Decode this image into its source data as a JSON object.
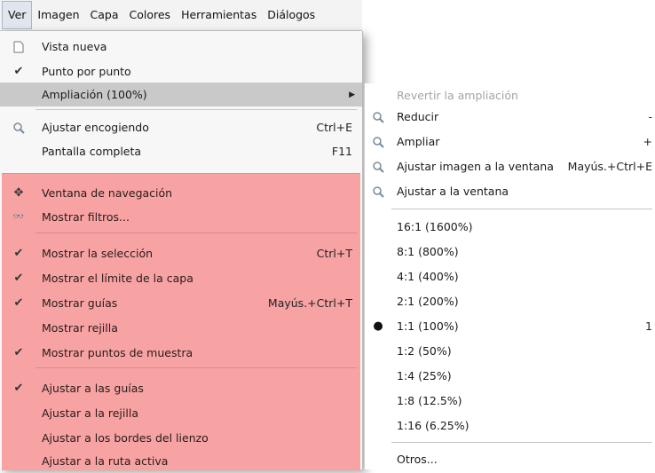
{
  "menubar": {
    "items": [
      "Ver",
      "Imagen",
      "Capa",
      "Colores",
      "Herramientas",
      "Diálogos"
    ]
  },
  "main_menu": {
    "vista_nueva": "Vista nueva",
    "punto_por_punto": "Punto por punto",
    "ampliacion": "Ampliación (100%)",
    "ajustar_encogiendo": "Ajustar encogiendo",
    "ajustar_encogiendo_sc": "Ctrl+E",
    "pantalla_completa": "Pantalla completa",
    "pantalla_completa_sc": "F11",
    "ventana_navegacion": "Ventana de navegación",
    "mostrar_filtros": "Mostrar filtros...",
    "mostrar_seleccion": "Mostrar la selección",
    "mostrar_seleccion_sc": "Ctrl+T",
    "mostrar_limite": "Mostrar el límite de la capa",
    "mostrar_guias": "Mostrar guías",
    "mostrar_guias_sc": "Mayús.+Ctrl+T",
    "mostrar_rejilla": "Mostrar rejilla",
    "mostrar_puntos": "Mostrar puntos de muestra",
    "ajustar_guias": "Ajustar a las guías",
    "ajustar_rejilla": "Ajustar a la rejilla",
    "ajustar_bordes": "Ajustar a los bordes del lienzo",
    "ajustar_ruta": "Ajustar a la ruta activa"
  },
  "sub_menu": {
    "revertir": "Revertir la ampliación",
    "reducir": "Reducir",
    "reducir_sc": "-",
    "ampliar": "Ampliar",
    "ampliar_sc": "+",
    "ajustar_imagen": "Ajustar imagen a la ventana",
    "ajustar_imagen_sc": "Mayús.+Ctrl+E",
    "ajustar_ventana": "Ajustar a la ventana",
    "z1600": "16:1 (1600%)",
    "z800": "8:1 (800%)",
    "z400": "4:1 (400%)",
    "z200": "2:1 (200%)",
    "z100": "1:1 (100%)",
    "z100_sc": "1",
    "z50": "1:2 (50%)",
    "z25": "1:4 (25%)",
    "z12": "1:8 (12.5%)",
    "z6": "1:16 (6.25%)",
    "otros": "Otros..."
  },
  "icons": {
    "page": "page-icon",
    "check": "checkmark-icon",
    "zoom": "magnifier-icon",
    "navigation": "move-cross-icon",
    "filters": "glasses-icon",
    "bullet": "radio-bullet-icon",
    "arrow": "submenu-arrow-icon"
  },
  "colors": {
    "highlight_pink": "#f7a3a3",
    "selected_item": "#c9c9c9"
  }
}
